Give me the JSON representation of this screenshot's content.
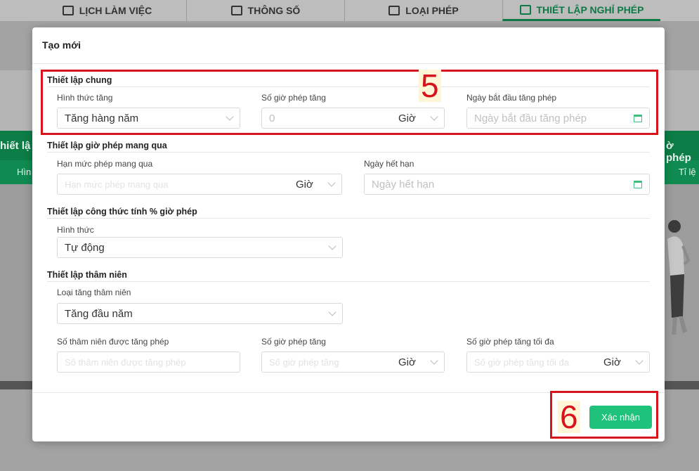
{
  "tabs": [
    {
      "label": "LỊCH LÀM VIỆC",
      "icon": "calendar-icon"
    },
    {
      "label": "THÔNG SỐ",
      "icon": "camera-icon"
    },
    {
      "label": "LOẠI PHÉP",
      "icon": "house-icon"
    },
    {
      "label": "THIẾT LẬP NGHỈ PHÉP",
      "icon": "house-settings-icon"
    }
  ],
  "background": {
    "left_head": "hiết lậ",
    "right_head": "ờ phép",
    "left_sub": "Hìn",
    "right_sub": "Tỉ lệ"
  },
  "modal": {
    "title": "Tạo mới",
    "confirm_label": "Xác nhận",
    "general": {
      "title": "Thiết lập chung",
      "increase_type": {
        "label": "Hình thức tăng",
        "value": "Tăng hàng năm"
      },
      "hours_increase": {
        "label": "Số giờ phép tăng",
        "placeholder": "0",
        "unit": "Giờ"
      },
      "start_date": {
        "label": "Ngày bắt đầu tăng phép",
        "placeholder": "Ngày bắt đầu tăng phép"
      }
    },
    "carry_over": {
      "title": "Thiết lập giờ phép mang qua",
      "limit": {
        "label": "Hạn mức phép mang qua",
        "placeholder": "Hạn mức phép mang qua",
        "unit": "Giờ"
      },
      "expiry": {
        "label": "Ngày hết hạn",
        "placeholder": "Ngày hết hạn"
      }
    },
    "formula": {
      "title": "Thiết lập công thức tính % giờ phép",
      "type": {
        "label": "Hình thức",
        "value": "Tự động"
      }
    },
    "seniority": {
      "title": "Thiết lập thâm niên",
      "type": {
        "label": "Loại tăng thâm niên",
        "value": "Tăng đầu năm"
      },
      "years": {
        "label": "Số thâm niên được tăng phép",
        "placeholder": "Số thâm niên được tăng phép"
      },
      "hours": {
        "label": "Số giờ phép tăng",
        "placeholder": "Số giờ phép tăng",
        "unit": "Giờ"
      },
      "max_hours": {
        "label": "Số giờ phép tăng tối đa",
        "placeholder": "Số giờ phép tăng tối đa",
        "unit": "Giờ"
      }
    }
  },
  "annotations": {
    "step5": "5",
    "step6": "6",
    "color": "#d7141b"
  },
  "colors": {
    "accent": "#1fc27a",
    "background_green": "#0d7d47"
  }
}
